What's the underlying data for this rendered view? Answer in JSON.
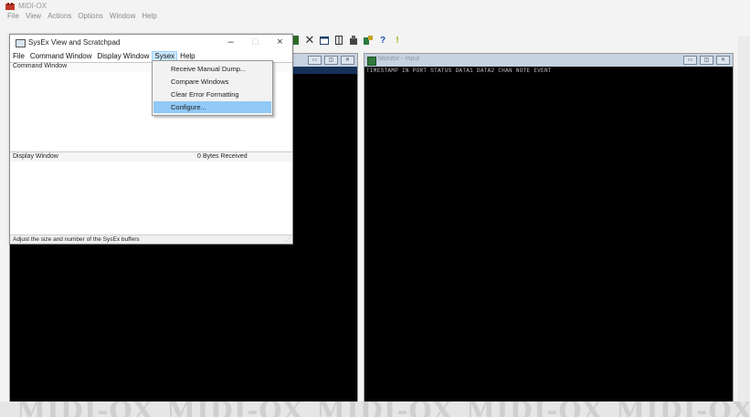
{
  "app": {
    "title": "MIDI-OX"
  },
  "main_menu": [
    "File",
    "View",
    "Actions",
    "Options",
    "Window",
    "Help"
  ],
  "toolbar": {
    "help_glyph": "?",
    "alert_glyph": "!"
  },
  "sysex_window": {
    "title": "SysEx View and Scratchpad",
    "controls": {
      "minimize": "–",
      "maximize": "□",
      "close": "×"
    },
    "menu": [
      "File",
      "Command Window",
      "Display Window",
      "Sysex",
      "Help"
    ],
    "command_window_label": "Command Window",
    "display_window_label": "Display Window",
    "bytes_received_count": "0",
    "bytes_received_label": "Bytes Received",
    "status_text": "Adjust the size and number of the SysEx buffers"
  },
  "sysex_dropdown": {
    "items": [
      "Receive Manual Dump...",
      "Compare Windows",
      "Clear Error Formatting",
      "Configure..."
    ],
    "highlighted_index": 3
  },
  "monitor_window": {
    "title": "Monitor - Input",
    "header": "TIMESTAMP IN PORT STATUS DATA1 DATA2 CHAN NOTE EVENT"
  },
  "watermark": {
    "text": "MIDI-OX"
  },
  "colors": {
    "accent_highlight": "#91c9f7",
    "active_menu": "#cce8ff",
    "monitor_bg": "#000000"
  }
}
